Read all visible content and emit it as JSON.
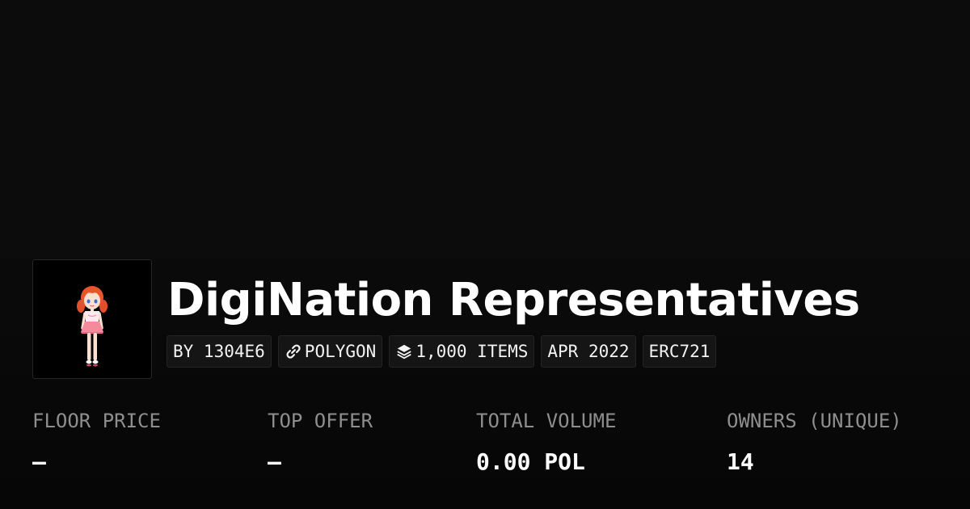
{
  "collection": {
    "name": "DigiNation Representatives",
    "creator": "BY 1304E6",
    "chain": "POLYGON",
    "items": "1,000 ITEMS",
    "created": "APR 2022",
    "standard": "ERC721"
  },
  "icons": {
    "avatar": "cartoon-girl-avatar",
    "chain": "link-icon",
    "items": "layers-icon"
  },
  "stats": [
    {
      "label": "FLOOR PRICE",
      "value": "—"
    },
    {
      "label": "TOP OFFER",
      "value": "—"
    },
    {
      "label": "TOTAL VOLUME",
      "value": "0.00 POL"
    },
    {
      "label": "OWNERS (UNIQUE)",
      "value": "14"
    }
  ],
  "colors": {
    "background": "#0a0a0a",
    "chip_bg": "#151515",
    "label_gray": "#8e8e8e",
    "hair": "#e8552a",
    "skirt": "#f48a9c"
  }
}
